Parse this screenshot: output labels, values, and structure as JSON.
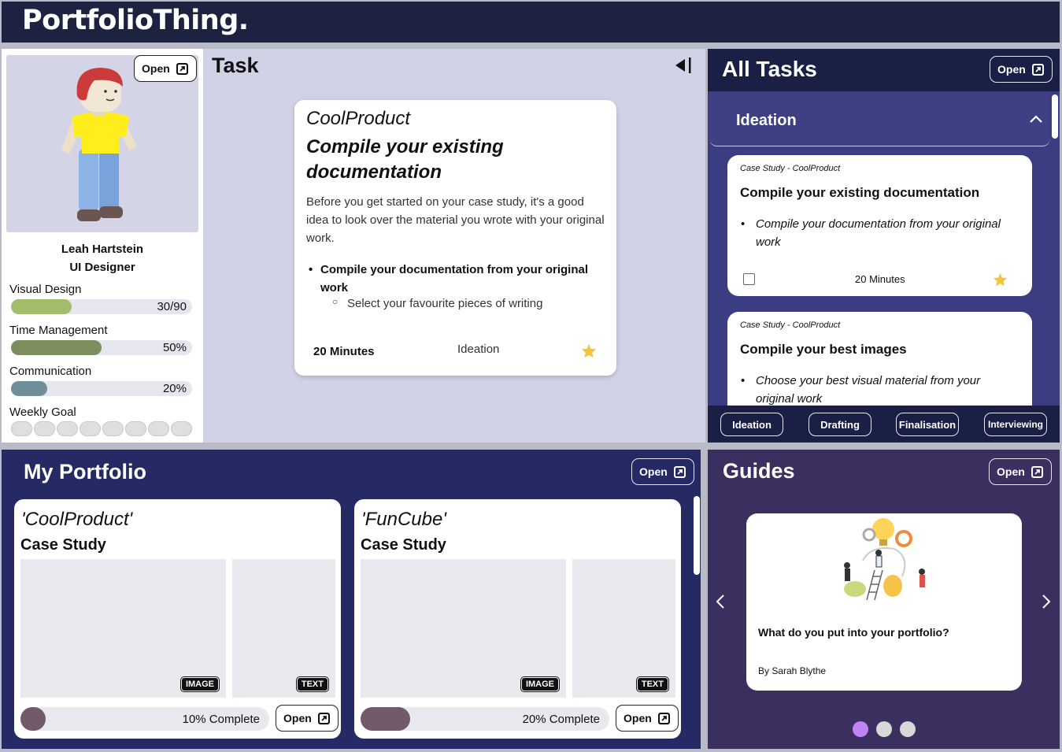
{
  "app": {
    "logo": "PortfolioThing."
  },
  "profile": {
    "open_label": "Open",
    "name": "Leah Hartstein",
    "role": "UI Designer",
    "skills": [
      {
        "label": "Visual Design",
        "value": "30/90",
        "fraction": 0.333,
        "color": "#a3bd6c"
      },
      {
        "label": "Time Management",
        "value": "50%",
        "fraction": 0.5,
        "color": "#7c8e5e"
      },
      {
        "label": "Communication",
        "value": "20%",
        "fraction": 0.2,
        "color": "#6e8f97"
      }
    ],
    "weekly_goal_label": "Weekly Goal",
    "weekly_goal_total": 8,
    "weekly_goal_done": 0
  },
  "task": {
    "title": "Task",
    "product": "CoolProduct",
    "heading": "Compile your existing documentation",
    "description": "Before you get started on your case study, it's a good idea to look over the material you wrote with your original work.",
    "bullet": "Compile your documentation from your original work",
    "sub_bullet": "Select your favourite pieces of writing",
    "duration": "20 Minutes",
    "phase": "Ideation",
    "icons": {
      "collapse": "collapse-panel-icon",
      "star": "star-icon"
    }
  },
  "all_tasks": {
    "title": "All Tasks",
    "open_label": "Open",
    "section": "Ideation",
    "cards": [
      {
        "subtitle": "Case Study - CoolProduct",
        "title": "Compile your existing documentation",
        "bullet": "Compile your documentation from your original work",
        "duration": "20 Minutes"
      },
      {
        "subtitle": "Case Study - CoolProduct",
        "title": "Compile your best images",
        "bullet": "Choose your best visual material from your original work"
      }
    ],
    "phases": [
      "Ideation",
      "Drafting",
      "Finalisation",
      "Interviewing"
    ]
  },
  "portfolio": {
    "title": "My Portfolio",
    "open_label": "Open",
    "items": [
      {
        "name": "'CoolProduct'",
        "type": "Case Study",
        "image_tag": "IMAGE",
        "text_tag": "TEXT",
        "progress_text": "10% Complete",
        "fraction": 0.1,
        "open_label": "Open"
      },
      {
        "name": "'FunCube'",
        "type": "Case Study",
        "image_tag": "IMAGE",
        "text_tag": "TEXT",
        "progress_text": "20% Complete",
        "fraction": 0.2,
        "open_label": "Open"
      }
    ]
  },
  "guides": {
    "title": "Guides",
    "open_label": "Open",
    "card_title": "What do you put into your portfolio?",
    "author": "By Sarah Blythe",
    "page_count": 3,
    "active_page": 1
  },
  "colors": {
    "header": "#1c2240",
    "all_tasks": "#3a3d82",
    "portfolio": "#252a65",
    "guides": "#3a2f5e",
    "star": "#f5c23c",
    "carousel_active": "#c083f5"
  }
}
